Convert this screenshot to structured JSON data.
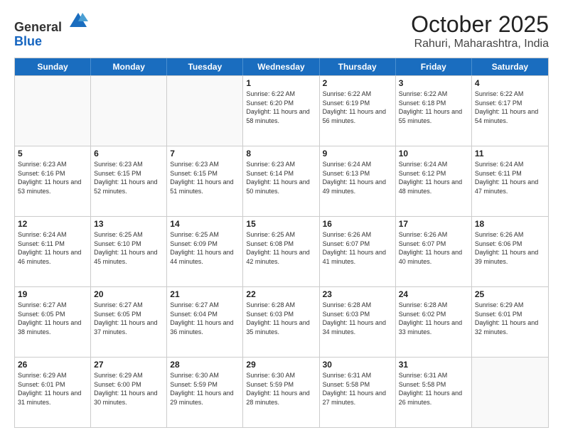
{
  "header": {
    "logo_general": "General",
    "logo_blue": "Blue",
    "title": "October 2025",
    "subtitle": "Rahuri, Maharashtra, India"
  },
  "weekdays": [
    "Sunday",
    "Monday",
    "Tuesday",
    "Wednesday",
    "Thursday",
    "Friday",
    "Saturday"
  ],
  "weeks": [
    [
      {
        "day": "",
        "sunrise": "",
        "sunset": "",
        "daylight": ""
      },
      {
        "day": "",
        "sunrise": "",
        "sunset": "",
        "daylight": ""
      },
      {
        "day": "",
        "sunrise": "",
        "sunset": "",
        "daylight": ""
      },
      {
        "day": "1",
        "sunrise": "Sunrise: 6:22 AM",
        "sunset": "Sunset: 6:20 PM",
        "daylight": "Daylight: 11 hours and 58 minutes."
      },
      {
        "day": "2",
        "sunrise": "Sunrise: 6:22 AM",
        "sunset": "Sunset: 6:19 PM",
        "daylight": "Daylight: 11 hours and 56 minutes."
      },
      {
        "day": "3",
        "sunrise": "Sunrise: 6:22 AM",
        "sunset": "Sunset: 6:18 PM",
        "daylight": "Daylight: 11 hours and 55 minutes."
      },
      {
        "day": "4",
        "sunrise": "Sunrise: 6:22 AM",
        "sunset": "Sunset: 6:17 PM",
        "daylight": "Daylight: 11 hours and 54 minutes."
      }
    ],
    [
      {
        "day": "5",
        "sunrise": "Sunrise: 6:23 AM",
        "sunset": "Sunset: 6:16 PM",
        "daylight": "Daylight: 11 hours and 53 minutes."
      },
      {
        "day": "6",
        "sunrise": "Sunrise: 6:23 AM",
        "sunset": "Sunset: 6:15 PM",
        "daylight": "Daylight: 11 hours and 52 minutes."
      },
      {
        "day": "7",
        "sunrise": "Sunrise: 6:23 AM",
        "sunset": "Sunset: 6:15 PM",
        "daylight": "Daylight: 11 hours and 51 minutes."
      },
      {
        "day": "8",
        "sunrise": "Sunrise: 6:23 AM",
        "sunset": "Sunset: 6:14 PM",
        "daylight": "Daylight: 11 hours and 50 minutes."
      },
      {
        "day": "9",
        "sunrise": "Sunrise: 6:24 AM",
        "sunset": "Sunset: 6:13 PM",
        "daylight": "Daylight: 11 hours and 49 minutes."
      },
      {
        "day": "10",
        "sunrise": "Sunrise: 6:24 AM",
        "sunset": "Sunset: 6:12 PM",
        "daylight": "Daylight: 11 hours and 48 minutes."
      },
      {
        "day": "11",
        "sunrise": "Sunrise: 6:24 AM",
        "sunset": "Sunset: 6:11 PM",
        "daylight": "Daylight: 11 hours and 47 minutes."
      }
    ],
    [
      {
        "day": "12",
        "sunrise": "Sunrise: 6:24 AM",
        "sunset": "Sunset: 6:11 PM",
        "daylight": "Daylight: 11 hours and 46 minutes."
      },
      {
        "day": "13",
        "sunrise": "Sunrise: 6:25 AM",
        "sunset": "Sunset: 6:10 PM",
        "daylight": "Daylight: 11 hours and 45 minutes."
      },
      {
        "day": "14",
        "sunrise": "Sunrise: 6:25 AM",
        "sunset": "Sunset: 6:09 PM",
        "daylight": "Daylight: 11 hours and 44 minutes."
      },
      {
        "day": "15",
        "sunrise": "Sunrise: 6:25 AM",
        "sunset": "Sunset: 6:08 PM",
        "daylight": "Daylight: 11 hours and 42 minutes."
      },
      {
        "day": "16",
        "sunrise": "Sunrise: 6:26 AM",
        "sunset": "Sunset: 6:07 PM",
        "daylight": "Daylight: 11 hours and 41 minutes."
      },
      {
        "day": "17",
        "sunrise": "Sunrise: 6:26 AM",
        "sunset": "Sunset: 6:07 PM",
        "daylight": "Daylight: 11 hours and 40 minutes."
      },
      {
        "day": "18",
        "sunrise": "Sunrise: 6:26 AM",
        "sunset": "Sunset: 6:06 PM",
        "daylight": "Daylight: 11 hours and 39 minutes."
      }
    ],
    [
      {
        "day": "19",
        "sunrise": "Sunrise: 6:27 AM",
        "sunset": "Sunset: 6:05 PM",
        "daylight": "Daylight: 11 hours and 38 minutes."
      },
      {
        "day": "20",
        "sunrise": "Sunrise: 6:27 AM",
        "sunset": "Sunset: 6:05 PM",
        "daylight": "Daylight: 11 hours and 37 minutes."
      },
      {
        "day": "21",
        "sunrise": "Sunrise: 6:27 AM",
        "sunset": "Sunset: 6:04 PM",
        "daylight": "Daylight: 11 hours and 36 minutes."
      },
      {
        "day": "22",
        "sunrise": "Sunrise: 6:28 AM",
        "sunset": "Sunset: 6:03 PM",
        "daylight": "Daylight: 11 hours and 35 minutes."
      },
      {
        "day": "23",
        "sunrise": "Sunrise: 6:28 AM",
        "sunset": "Sunset: 6:03 PM",
        "daylight": "Daylight: 11 hours and 34 minutes."
      },
      {
        "day": "24",
        "sunrise": "Sunrise: 6:28 AM",
        "sunset": "Sunset: 6:02 PM",
        "daylight": "Daylight: 11 hours and 33 minutes."
      },
      {
        "day": "25",
        "sunrise": "Sunrise: 6:29 AM",
        "sunset": "Sunset: 6:01 PM",
        "daylight": "Daylight: 11 hours and 32 minutes."
      }
    ],
    [
      {
        "day": "26",
        "sunrise": "Sunrise: 6:29 AM",
        "sunset": "Sunset: 6:01 PM",
        "daylight": "Daylight: 11 hours and 31 minutes."
      },
      {
        "day": "27",
        "sunrise": "Sunrise: 6:29 AM",
        "sunset": "Sunset: 6:00 PM",
        "daylight": "Daylight: 11 hours and 30 minutes."
      },
      {
        "day": "28",
        "sunrise": "Sunrise: 6:30 AM",
        "sunset": "Sunset: 5:59 PM",
        "daylight": "Daylight: 11 hours and 29 minutes."
      },
      {
        "day": "29",
        "sunrise": "Sunrise: 6:30 AM",
        "sunset": "Sunset: 5:59 PM",
        "daylight": "Daylight: 11 hours and 28 minutes."
      },
      {
        "day": "30",
        "sunrise": "Sunrise: 6:31 AM",
        "sunset": "Sunset: 5:58 PM",
        "daylight": "Daylight: 11 hours and 27 minutes."
      },
      {
        "day": "31",
        "sunrise": "Sunrise: 6:31 AM",
        "sunset": "Sunset: 5:58 PM",
        "daylight": "Daylight: 11 hours and 26 minutes."
      },
      {
        "day": "",
        "sunrise": "",
        "sunset": "",
        "daylight": ""
      }
    ]
  ]
}
